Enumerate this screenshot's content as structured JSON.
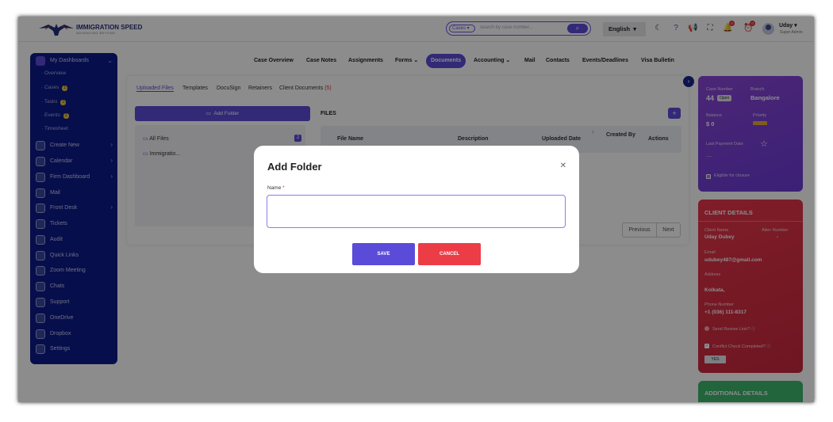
{
  "header": {
    "logo_text": "IMMIGRATION SPEED",
    "logo_subtitle": "ADVANCING BEYOND",
    "search_scope": "Cases",
    "search_placeholder": "search by case number...",
    "language": "English",
    "notification_count": "0",
    "alert_count": "0",
    "user_name": "Uday",
    "user_role": "Super Admin"
  },
  "sidebar": {
    "title": "My Dashboards",
    "subitems": [
      {
        "label": "Overview",
        "count": ""
      },
      {
        "label": "Cases",
        "count": "1"
      },
      {
        "label": "Tasks",
        "count": "1"
      },
      {
        "label": "Events",
        "count": "2"
      },
      {
        "label": "Timesheet",
        "count": ""
      }
    ],
    "items": [
      {
        "label": "Create New"
      },
      {
        "label": "Calendar"
      },
      {
        "label": "Firm Dashboard"
      },
      {
        "label": "Mail"
      },
      {
        "label": "Front Desk"
      },
      {
        "label": "Tickets"
      },
      {
        "label": "Audit"
      },
      {
        "label": "Quick Links"
      },
      {
        "label": "Zoom Meeting"
      },
      {
        "label": "Chats"
      },
      {
        "label": "Support"
      },
      {
        "label": "OneDrive"
      },
      {
        "label": "Dropbox"
      },
      {
        "label": "Settings"
      }
    ]
  },
  "tabs": [
    "Case Overview",
    "Case Notes",
    "Assignments",
    "Forms",
    "Documents",
    "Accounting",
    "Mail",
    "Contacts",
    "Events/Deadlines",
    "Visa Bulletin"
  ],
  "active_tab": "Documents",
  "documents": {
    "subtabs": [
      "Uploaded Files",
      "Templates",
      "DocuSign",
      "Retainers",
      "Client Documents"
    ],
    "client_documents_count": "(5)",
    "add_folder_label": "Add Folder",
    "all_files_label": "All Files",
    "all_files_count": "2",
    "folder_name": "Immigratio...",
    "files_heading": "FILES",
    "columns": [
      "File Name",
      "Description",
      "Uploaded Date",
      "Created By",
      "Actions"
    ],
    "prev_label": "Previous",
    "next_label": "Next"
  },
  "case_card": {
    "case_number_label": "Case Number",
    "case_number": "44",
    "status": "Open",
    "branch_label": "Branch",
    "branch": "Bangalore",
    "balance_label": "Balance",
    "balance": "$ 0",
    "priority_label": "Priority",
    "last_payment_label": "Last Payment Date",
    "last_payment": "----",
    "closure_label": "Eligible for closure"
  },
  "client": {
    "heading": "CLIENT DETAILS",
    "name_label": "Client Name",
    "name": "Uday Dubey",
    "alien_label": "Alien Number",
    "alien": "-",
    "email_label": "Email",
    "email": "udubey487@gmail.com",
    "address_label": "Address",
    "address": "Kolkata,",
    "phone_label": "Phone Number",
    "phone": "+1 (036) 111-8317",
    "review_label": "Send Review Link?",
    "conflict_label": "Conflict Check Completed?",
    "conflict_value": "YES"
  },
  "additional": {
    "heading": "ADDITIONAL DETAILS"
  },
  "modal": {
    "title": "Add Folder",
    "name_label": "Name",
    "required_mark": "*",
    "name_value": "",
    "save_label": "SAVE",
    "cancel_label": "CANCEL"
  },
  "colors": {
    "accent": "#5b4bd9",
    "sidebar": "#0e1b8a",
    "danger": "#ec3d47",
    "purple_card": "#7b42d8",
    "red_card": "#dc3045"
  }
}
